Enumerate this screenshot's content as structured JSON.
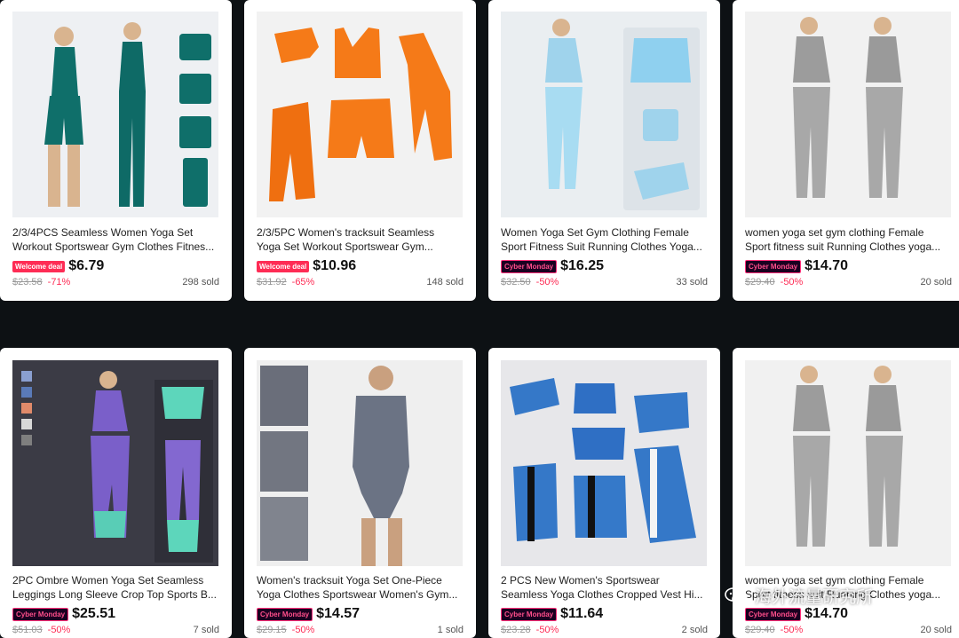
{
  "products": [
    {
      "title1": "2/3/4PCS Seamless Women Yoga Set",
      "title2": "Workout Sportswear Gym Clothes Fitnes...",
      "badge": "Welcome deal",
      "badge_type": "welcome",
      "price": "$6.79",
      "orig": "$23.58",
      "disc": "-71%",
      "sold": "298 sold"
    },
    {
      "title1": "2/3/5PC Women's tracksuit Seamless",
      "title2": "Yoga Set Workout Sportswear Gym...",
      "badge": "Welcome deal",
      "badge_type": "welcome",
      "price": "$10.96",
      "orig": "$31.92",
      "disc": "-65%",
      "sold": "148 sold"
    },
    {
      "title1": "Women Yoga Set Gym Clothing Female",
      "title2": "Sport Fitness Suit Running Clothes Yoga...",
      "badge": "Cyber Monday",
      "badge_type": "cyber",
      "price": "$16.25",
      "orig": "$32.50",
      "disc": "-50%",
      "sold": "33 sold"
    },
    {
      "title1": "women yoga set gym clothing Female",
      "title2": "Sport fitness suit Running Clothes yoga...",
      "badge": "Cyber Monday",
      "badge_type": "cyber",
      "price": "$14.70",
      "orig": "$29.40",
      "disc": "-50%",
      "sold": "20 sold"
    },
    {
      "title1": "2PC Ombre Women Yoga Set Seamless",
      "title2": "Leggings Long Sleeve Crop Top Sports B...",
      "badge": "Cyber Monday",
      "badge_type": "cyber",
      "price": "$25.51",
      "orig": "$51.03",
      "disc": "-50%",
      "sold": "7 sold"
    },
    {
      "title1": "Women's tracksuit Yoga Set One-Piece",
      "title2": "Yoga Clothes Sportswear Women's Gym...",
      "badge": "Cyber Monday",
      "badge_type": "cyber",
      "price": "$14.57",
      "orig": "$29.15",
      "disc": "-50%",
      "sold": "1 sold"
    },
    {
      "title1": "2 PCS New Women's Sportswear",
      "title2": "Seamless Yoga Clothes Cropped Vest Hi...",
      "badge": "Cyber Monday",
      "badge_type": "cyber",
      "price": "$11.64",
      "orig": "$23.28",
      "disc": "-50%",
      "sold": "2 sold"
    },
    {
      "title1": "women yoga set gym clothing Female",
      "title2": "Sport fitness suit Running Clothes yoga...",
      "badge": "Cyber Monday",
      "badge_type": "cyber",
      "price": "$14.70",
      "orig": "$29.40",
      "disc": "-50%",
      "sold": "20 sold"
    }
  ],
  "watermark": {
    "text": "海外流量研究所",
    "icon": "wechat-icon"
  },
  "colors": {
    "page_bg": "#0d1114",
    "discount": "#fe2c55",
    "welcome_badge": "#fe2c55",
    "cyber_badge": "#1a0020"
  }
}
